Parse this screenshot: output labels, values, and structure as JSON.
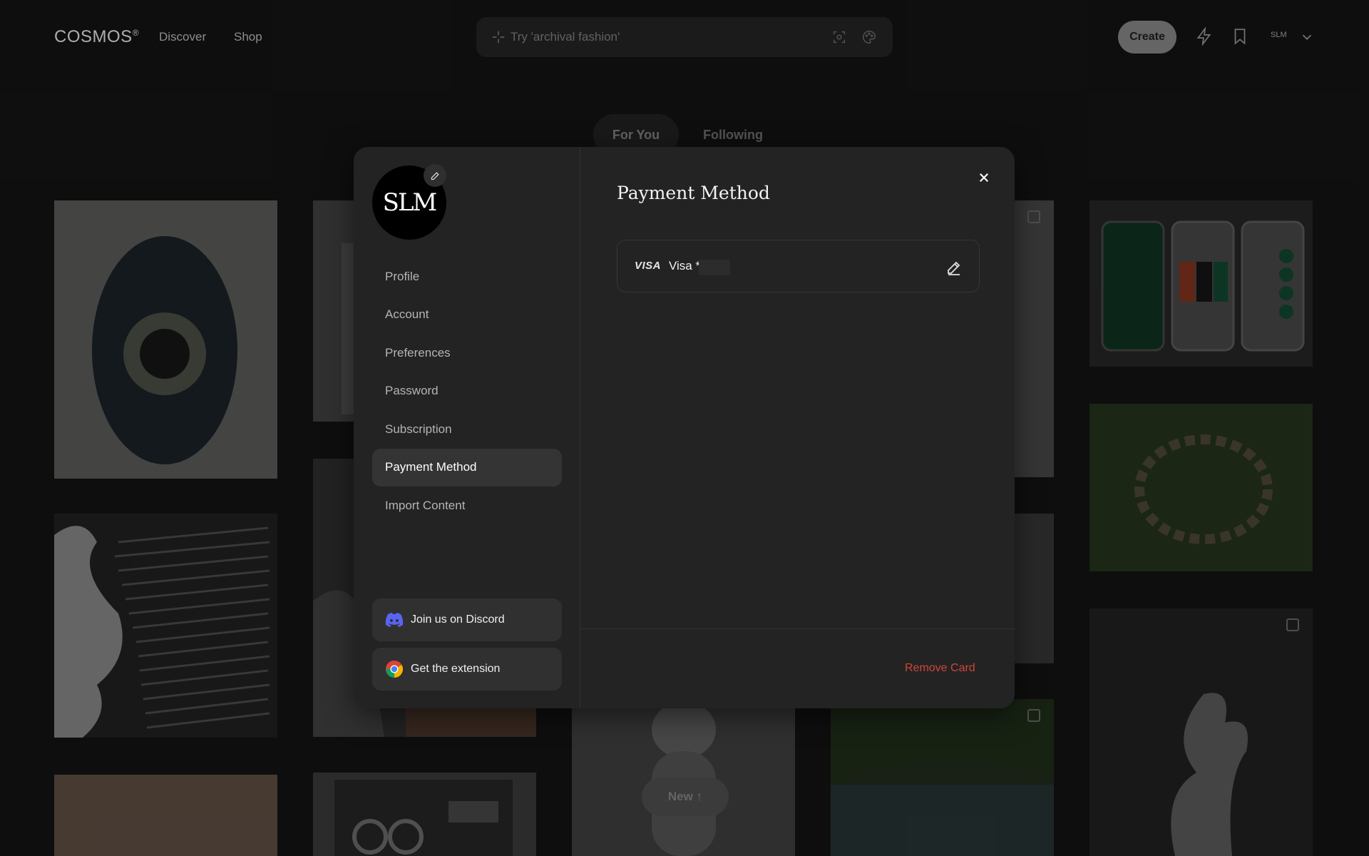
{
  "header": {
    "logo": "COSMOS",
    "logo_mark": "®",
    "nav": [
      "Discover",
      "Shop"
    ],
    "search_placeholder": "Try 'archival fashion'",
    "create_label": "Create",
    "user_short": "SLM"
  },
  "feed_tabs": {
    "active": "For You",
    "other": "Following"
  },
  "new_pill": "New ↑",
  "settings": {
    "avatar_text": "SLM",
    "menu": [
      "Profile",
      "Account",
      "Preferences",
      "Password",
      "Subscription",
      "Payment Method",
      "Import Content"
    ],
    "active_item": "Payment Method",
    "discord_label": "Join us on Discord",
    "extension_label": "Get the extension",
    "title": "Payment Method",
    "card": {
      "brand_logo": "VISA",
      "label": "Visa *"
    },
    "remove_label": "Remove Card"
  },
  "colors": {
    "danger": "#d1453b",
    "discord": "#5865F2",
    "active_bg": "#343434"
  }
}
